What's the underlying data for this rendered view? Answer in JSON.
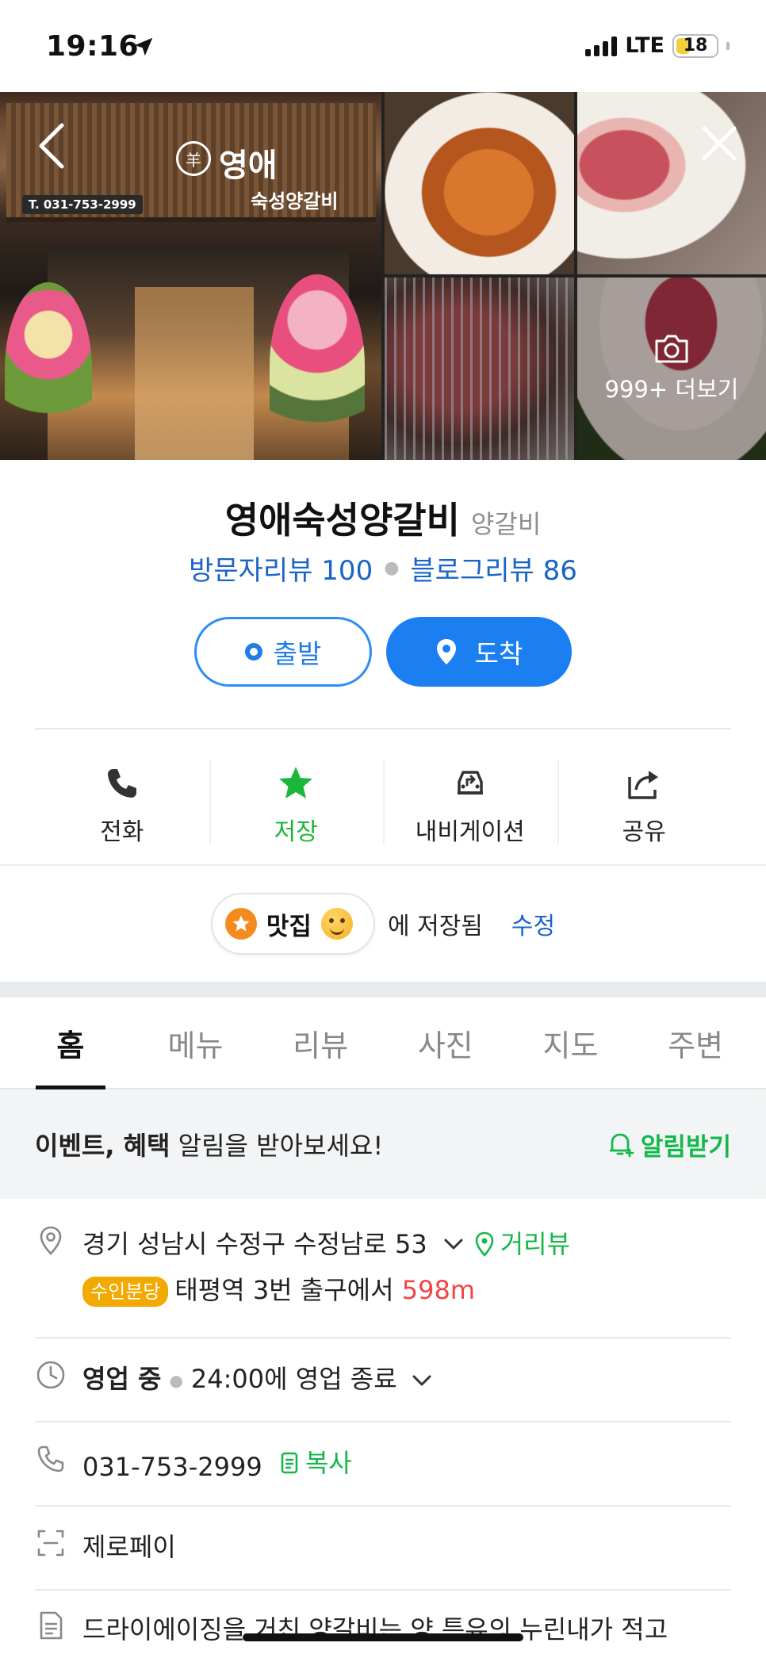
{
  "status_bar": {
    "time": "19:16",
    "network": "LTE",
    "battery": "18",
    "battery_level": 0.18
  },
  "photos": {
    "sign_name": "영애",
    "sign_sub": "숙성양갈비",
    "sign_phone": "T. 031-753-2999",
    "sign_logo": "羊",
    "more_label": "999+ 더보기"
  },
  "place": {
    "name": "영애숙성양갈비",
    "category": "양갈비",
    "visitor_reviews": "방문자리뷰 100",
    "blog_reviews": "블로그리뷰 86",
    "depart_label": "출발",
    "arrive_label": "도착"
  },
  "actions": [
    {
      "label": "전화",
      "icon": "phone-icon"
    },
    {
      "label": "저장",
      "icon": "star-icon"
    },
    {
      "label": "내비게이션",
      "icon": "car-navigation-icon"
    },
    {
      "label": "공유",
      "icon": "share-icon"
    }
  ],
  "saved": {
    "list_name": "맛집",
    "saved_text": "에 저장됨",
    "edit_label": "수정"
  },
  "tabs": [
    "홈",
    "메뉴",
    "리뷰",
    "사진",
    "지도",
    "주변"
  ],
  "active_tab": "홈",
  "notice": {
    "bold_text": "이벤트, 혜택",
    "text": " 알림을 받아보세요!",
    "button": "알림받기"
  },
  "info": {
    "address": "경기 성남시 수정구 수정남로 53",
    "street_view": "거리뷰",
    "subway_line": "수인분당",
    "station_text": "태평역 3번 출구에서",
    "distance": "598m",
    "hours_status": "영업 중",
    "hours_detail": "24:00에 영업 종료",
    "phone": "031-753-2999",
    "copy_label": "복사",
    "payment": "제로페이",
    "description": "드라이에이징을 거친 양갈비는 양 특유의 누린내가 적고"
  },
  "colors": {
    "accent_blue": "#1b7ff2",
    "link_blue": "#1a64c8",
    "green": "#14b84a",
    "distance_red": "#f24545",
    "line_badge": "#f2a900"
  }
}
